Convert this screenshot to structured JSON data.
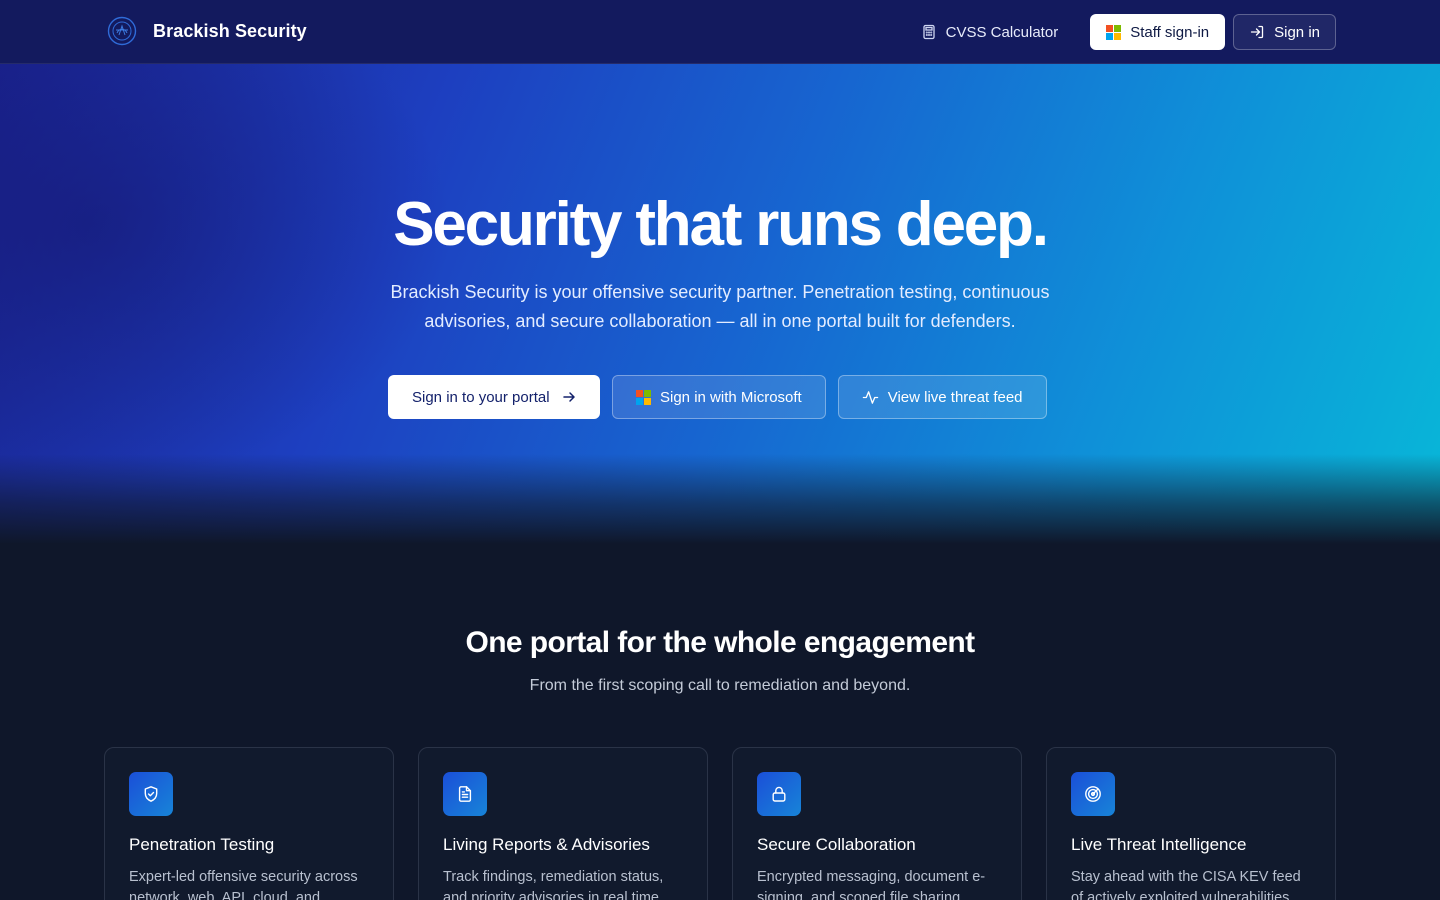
{
  "header": {
    "brand": "Brackish Security",
    "nav": {
      "cvss_label": "CVSS Calculator",
      "staff_label": "Staff sign-in",
      "signin_label": "Sign in"
    }
  },
  "hero": {
    "title": "Security that runs deep.",
    "subtitle": "Brackish Security is your offensive security partner. Penetration testing, continuous advisories, and secure collaboration — all in one portal built for defenders.",
    "cta_portal": "Sign in to your portal",
    "cta_microsoft": "Sign in with Microsoft",
    "cta_threat": "View live threat feed"
  },
  "features": {
    "title": "One portal for the whole engagement",
    "subtitle": "From the first scoping call to remediation and beyond.",
    "cards": [
      {
        "icon": "shield-icon",
        "title": "Penetration Testing",
        "desc": "Expert-led offensive security across network, web, API, cloud, and mobile."
      },
      {
        "icon": "document-icon",
        "title": "Living Reports & Advisories",
        "desc": "Track findings, remediation status, and priority advisories in real time."
      },
      {
        "icon": "lock-icon",
        "title": "Secure Collaboration",
        "desc": "Encrypted messaging, document e-signing, and scoped file sharing."
      },
      {
        "icon": "radar-icon",
        "title": "Live Threat Intelligence",
        "desc": "Stay ahead with the CISA KEV feed of actively exploited vulnerabilities."
      }
    ]
  },
  "colors": {
    "nav_bg": "#131a5e",
    "page_bg": "#0f172a",
    "accent": "#1b4fd8"
  }
}
